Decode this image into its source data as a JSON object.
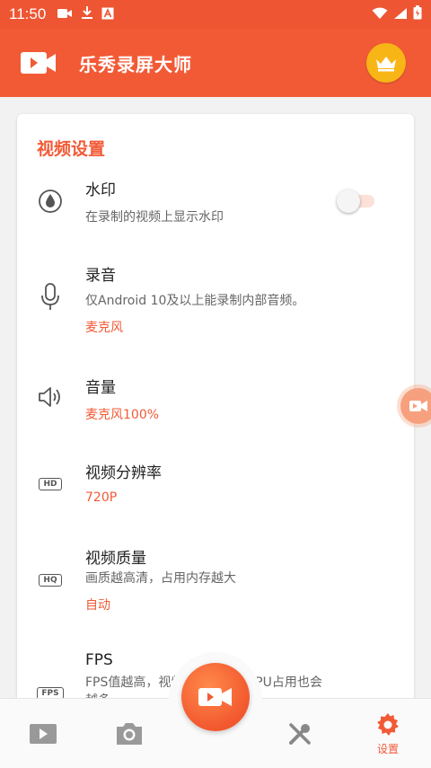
{
  "status_bar": {
    "time": "11:50"
  },
  "app": {
    "title": "乐秀录屏大师"
  },
  "section": {
    "title": "视频设置"
  },
  "settings": {
    "watermark": {
      "title": "水印",
      "desc": "在录制的视频上显示水印",
      "enabled": false
    },
    "audio": {
      "title": "录音",
      "desc": "仅Android 10及以上能录制内部音频。",
      "value": "麦克风"
    },
    "volume": {
      "title": "音量",
      "value": "麦克风100%"
    },
    "resolution": {
      "title": "视频分辨率",
      "value": "720P",
      "icon_text": "HD"
    },
    "quality": {
      "title": "视频质量",
      "desc": "画质越高清，占用内存越大",
      "value": "自动",
      "icon_text": "HQ"
    },
    "fps": {
      "title": "FPS",
      "desc": "FPS值越高，视频越流畅，但CPU占用也会",
      "desc2": "越多",
      "icon_text": "FPS"
    }
  },
  "bottom_nav": {
    "settings_label": "设置"
  },
  "colors": {
    "accent": "#f25a36",
    "status_bar": "#ee5533",
    "vip": "#f8b516"
  }
}
